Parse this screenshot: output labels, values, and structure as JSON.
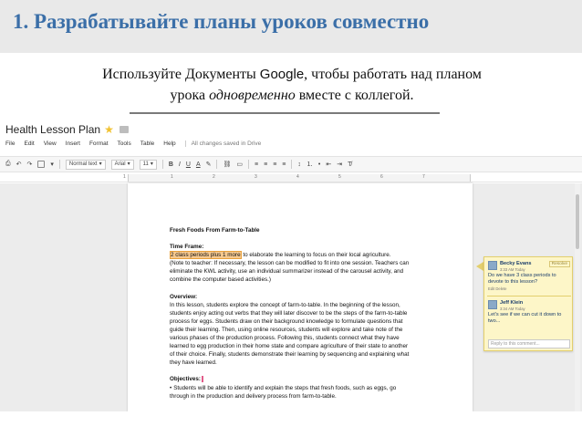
{
  "slide": {
    "title": "1. Разрабатывайте планы уроков совместно",
    "subtitle_part1": "Используйте Документы ",
    "subtitle_google": "Google",
    "subtitle_part2": ", чтобы работать над планом",
    "subtitle_part3": "урока ",
    "subtitle_em": "одновременно",
    "subtitle_part4": " вместе с коллегой."
  },
  "app": {
    "doc_title": "Health Lesson Plan",
    "menu": [
      "File",
      "Edit",
      "View",
      "Insert",
      "Format",
      "Tools",
      "Table",
      "Help"
    ],
    "saved_status": "All changes saved in Drive",
    "toolbar": {
      "style_select": "Normal text",
      "font_select": "Arial",
      "size_select": "11",
      "bold": "B",
      "italic": "I",
      "underline": "U",
      "text_color": "A"
    },
    "ruler_numbers": [
      "1",
      "1",
      "2",
      "3",
      "4",
      "5",
      "6",
      "7"
    ]
  },
  "document": {
    "heading": "Fresh Foods From Farm-to-Table",
    "time_frame_label": "Time Frame:",
    "time_frame_highlight": "2 class periods plus 1 more",
    "time_frame_line1_rest": " to elaborate the learning to focus on their local agriculture.",
    "time_frame_line2": "(Note to teacher: If necessary, the lesson can be modified to fit into one session. Teachers can",
    "time_frame_line3": "eliminate the KWL activity, use an individual summarizer instead of the carousel activity, and",
    "time_frame_line4": "combine the computer based activities.)",
    "overview_label": "Overview:",
    "overview_lines": [
      "In this lesson, students explore the concept of farm-to-table. In the beginning of the lesson,",
      "students enjoy acting out verbs that they will later discover to be the steps of the farm-to-table",
      "process for eggs. Students draw on their background knowledge to formulate questions that",
      "guide their learning. Then, using online resources, students will explore and take note of the",
      "various phases of the production process. Following this, students connect what they have",
      "learned to egg production in their home state and compare agriculture of their state to another",
      "of their choice. Finally, students demonstrate their learning by sequencing and explaining what",
      "they have learned."
    ],
    "objectives_label": "Objectives:",
    "objective_bullet": "•",
    "objective_line1": "Students will be able to identify and explain the steps that fresh foods, such as eggs, go",
    "objective_line2": "through in the production and delivery process from farm-to-table."
  },
  "comments": {
    "resolve_label": "Resolve",
    "entry1": {
      "name": "Becky Evans",
      "time": "3:33 AM Today",
      "text": "Do we have 3 class periods to devote to this lesson?",
      "edit": "Edit Delete"
    },
    "entry2": {
      "name": "Jeff Klein",
      "time": "3:34 AM Today",
      "text": "Let's see if we can cut it down to two..."
    },
    "reply_placeholder": "Reply to this comment..."
  }
}
